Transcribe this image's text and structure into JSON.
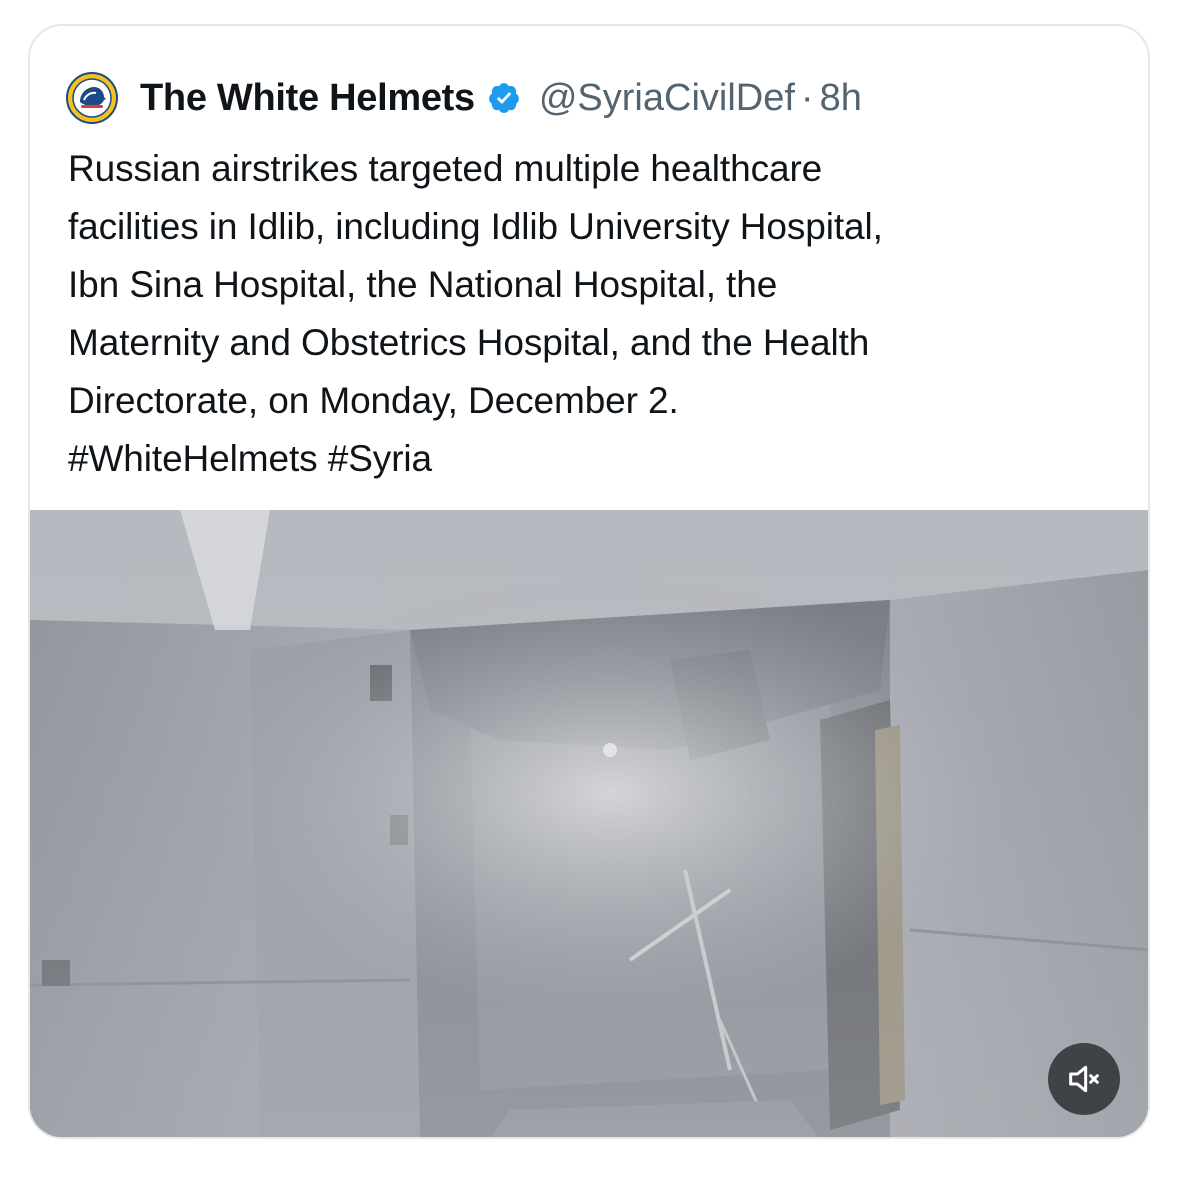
{
  "tweet": {
    "author": {
      "display_name": "The White Helmets",
      "handle": "@SyriaCivilDef",
      "separator": "·",
      "timestamp": "8h",
      "avatar_icon": "white-helmets-logo-icon",
      "verified_icon": "verified-badge-icon"
    },
    "text": "Russian airstrikes targeted multiple healthcare\nfacilities in Idlib, including Idlib University Hospital,\nIbn Sina Hospital, the National Hospital, the\nMaternity and Obstetrics Hospital, and the Health\nDirectorate, on Monday, December 2.\n#WhiteHelmets #Syria",
    "media": {
      "type": "video",
      "mute_icon": "speaker-muted-icon"
    }
  },
  "colors": {
    "text_primary": "#0f1419",
    "text_secondary": "#536471",
    "verified_blue": "#1d9bf0",
    "card_border": "#e4e7ea",
    "mute_button_bg": "#2c3034"
  }
}
